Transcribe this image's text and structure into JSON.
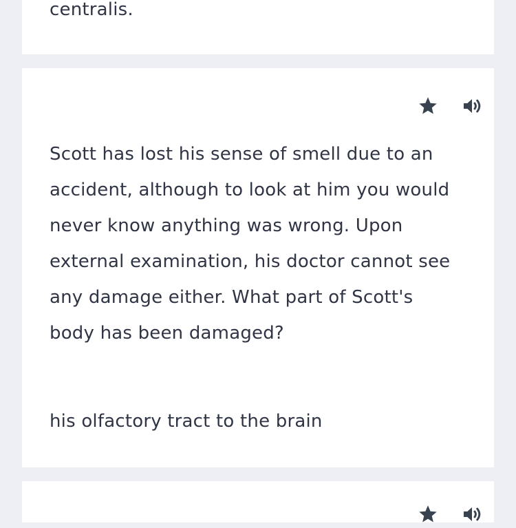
{
  "cards": [
    {
      "definition_fragment": "centralis."
    },
    {
      "term": "Scott has lost his sense of smell due to an accident, although to look at him you would never know anything was wrong. Upon external examination, his doctor cannot see any damage either. What part of Scott's body has been damaged?",
      "definition": "his olfactory tract to the brain",
      "icons": [
        "star-icon",
        "speaker-icon"
      ]
    },
    {
      "icons": [
        "star-icon",
        "speaker-icon"
      ]
    }
  ],
  "colors": {
    "background": "#edeff4",
    "card": "#ffffff",
    "text": "#303545",
    "icon": "#394350"
  }
}
